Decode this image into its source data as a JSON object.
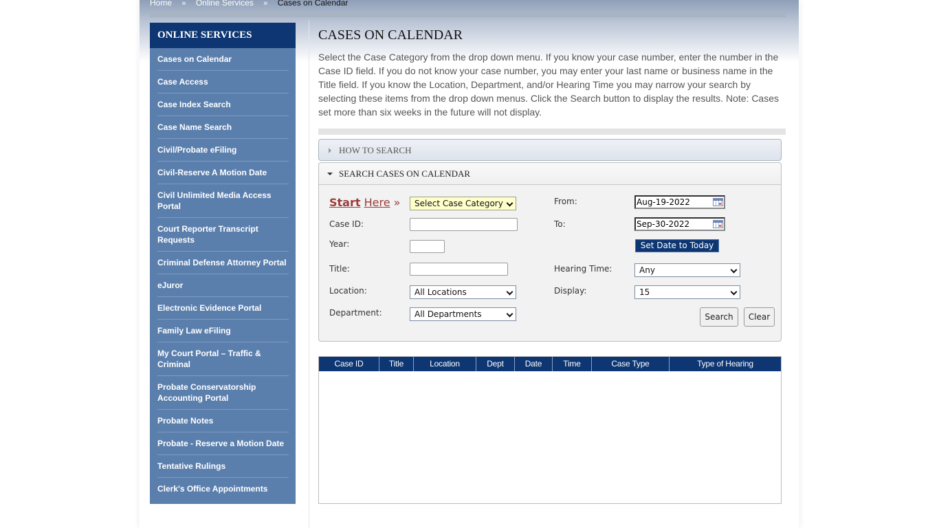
{
  "breadcrumb": {
    "items": [
      "Home",
      "Online Services"
    ],
    "separator": "»",
    "current": "Cases on Calendar"
  },
  "sidebar": {
    "title": "ONLINE SERVICES",
    "items": [
      "Cases on Calendar",
      "Case Access",
      "Case Index Search",
      "Case Name Search",
      "Civil/Probate eFiling",
      "Civil-Reserve A Motion Date",
      "Civil Unlimited Media Access Portal",
      "Court Reporter Transcript Requests",
      "Criminal Defense Attorney Portal",
      "eJuror",
      "Electronic Evidence Portal",
      "Family Law eFiling",
      "My Court Portal – Traffic & Criminal",
      "Probate Conservatorship Accounting Portal",
      "Probate Notes",
      "Probate - Reserve a Motion Date",
      "Tentative Rulings",
      "Clerk's Office Appointments"
    ]
  },
  "main": {
    "title": "CASES ON CALENDAR",
    "intro": "Select the Case Category from the drop down menu. If you know your case number, enter the number in the Case ID field. If you do not know your case number, you may enter your last name or business name in the Title field. If you know the Location, Department, and/or Hearing Time you may narrow your search by selecting these items from the drop down menus. Click the Search button to display the results. Note: Cases set more than six weeks in the future will not display."
  },
  "accordion": {
    "how_to_search": "HOW TO SEARCH",
    "search_cases": "SEARCH CASES ON CALENDAR"
  },
  "form": {
    "start_bold": "Start",
    "start_rest": "Here",
    "start_arrow": "»",
    "case_category": "Select Case Category",
    "case_id_label": "Case ID:",
    "case_id_value": "",
    "year_label": "Year:",
    "year_value": "",
    "title_label": "Title:",
    "title_value": "",
    "location_label": "Location:",
    "location_value": "All Locations",
    "department_label": "Department:",
    "department_value": "All Departments",
    "from_label": "From:",
    "from_value": "Aug-19-2022",
    "to_label": "To:",
    "to_value": "Sep-30-2022",
    "set_today_label": "Set Date to Today",
    "hearing_time_label": "Hearing Time:",
    "hearing_time_value": "Any",
    "display_label": "Display:",
    "display_value": "15",
    "search_label": "Search",
    "clear_label": "Clear"
  },
  "results": {
    "columns": [
      "Case ID",
      "Title",
      "Location",
      "Dept",
      "Date",
      "Time",
      "Case Type",
      "Type of Hearing"
    ],
    "rows": []
  },
  "colors": {
    "navy": "#0d3673",
    "sidebar_blue": "#5b7fad",
    "start_red": "#9c3b3b",
    "category_yellow": "#ffffcc"
  }
}
